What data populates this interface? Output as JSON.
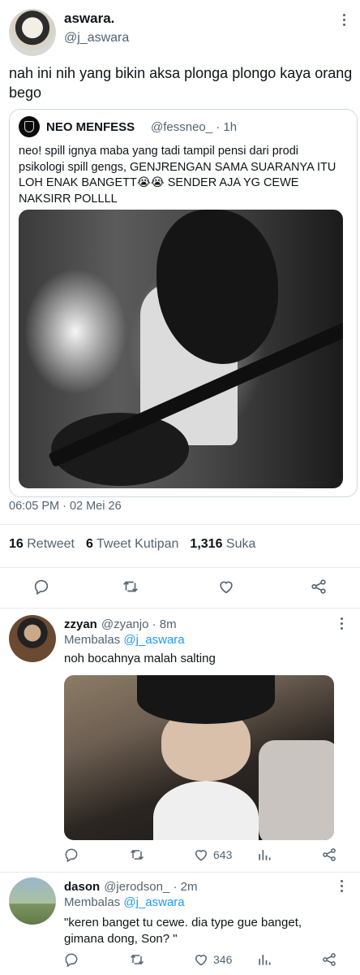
{
  "main_tweet": {
    "display_name": "aswara.",
    "handle": "@j_aswara",
    "text": "nah ini nih yang bikin aksa plonga plongo kaya orang bego",
    "timestamp": "06:05 PM · 02 Mei 26",
    "stats": {
      "retweets": "16",
      "retweets_label": "Retweet",
      "quotes": "6",
      "quotes_label": "Tweet Kutipan",
      "likes": "1,316",
      "likes_label": "Suka"
    }
  },
  "quoted_tweet": {
    "display_name": "NEO MENFESS",
    "handle_time": "@fessneo_ · 1h",
    "text": "neo! spill ignya maba yang tadi tampil pensi dari prodi psikologi spill gengs, GENJRENGAN SAMA SUARANYA ITU LOH ENAK BANGETT😭😭 SENDER AJA YG CEWE NAKSIRR POLLLL"
  },
  "replies": [
    {
      "display_name": "zzyan",
      "handle_time": "@zyanjo · 8m",
      "replying_label": "Membalas",
      "replying_to": "@j_aswara",
      "text": "noh bocahnya malah salting",
      "likes": "643"
    },
    {
      "display_name": "dason",
      "handle_time": "@jerodson_ · 2m",
      "replying_label": "Membalas",
      "replying_to": "@j_aswara",
      "text": "\"keren banget tu cewe. dia type gue banget, gimana dong, Son? \"",
      "likes": "346"
    }
  ],
  "icons": {
    "reply": "reply-icon",
    "retweet": "retweet-icon",
    "like": "heart-icon",
    "analytics": "analytics-icon",
    "share": "share-icon",
    "more": "more-icon"
  },
  "colors": {
    "text": "#0f1419",
    "muted": "#536471",
    "link": "#1d9bf0",
    "border": "#cfd9de"
  }
}
